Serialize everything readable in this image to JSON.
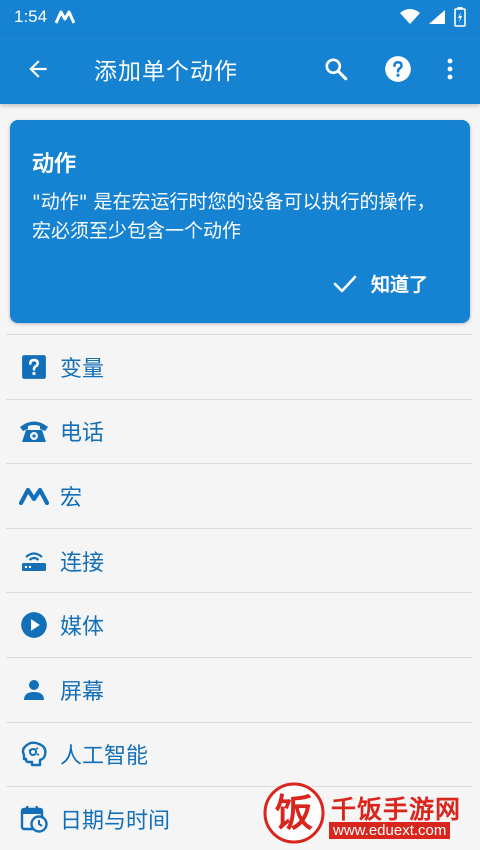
{
  "status": {
    "time": "1:54"
  },
  "appbar": {
    "title": "添加单个动作"
  },
  "card": {
    "title": "动作",
    "text": "\"动作\" 是在宏运行时您的设备可以执行的操作，宏必须至少包含一个动作",
    "ok_label": "知道了"
  },
  "categories": [
    {
      "label": "变量",
      "icon": "question-box-icon"
    },
    {
      "label": "电话",
      "icon": "phone-icon"
    },
    {
      "label": "宏",
      "icon": "macro-m-icon"
    },
    {
      "label": "连接",
      "icon": "router-icon"
    },
    {
      "label": "媒体",
      "icon": "play-circle-icon"
    },
    {
      "label": "屏幕",
      "icon": "person-icon"
    },
    {
      "label": "人工智能",
      "icon": "brain-icon"
    },
    {
      "label": "日期与时间",
      "icon": "calendar-clock-icon"
    }
  ],
  "watermark": {
    "title": "千饭手游网",
    "url": "www.eduext.com"
  },
  "colors": {
    "primary": "#1682d2",
    "text_blue": "#1370b8",
    "watermark_red": "#d9261c"
  }
}
